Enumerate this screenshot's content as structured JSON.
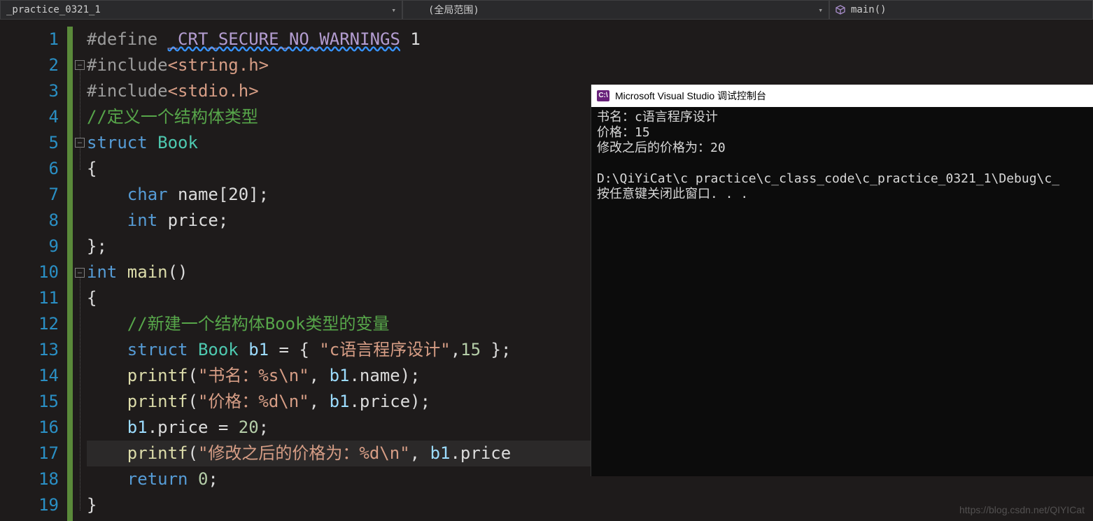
{
  "topbar": {
    "file_label": "_practice_0321_1",
    "scope_label": "(全局范围)",
    "func_label": "main()"
  },
  "gutter_start": 1,
  "gutter_end": 19,
  "code": {
    "l1_pp": "#define ",
    "l1_mac": "_CRT_SECURE_NO_WARNINGS",
    "l1_tail": " 1",
    "l2_pp": "#include",
    "l2_inc": "<string.h>",
    "l3_pp": "#include",
    "l3_inc": "<stdio.h>",
    "l4_cmt": "//定义一个结构体类型",
    "l5_kw": "struct ",
    "l5_typ": "Book",
    "l6_brace": "{",
    "l7_pre": "    ",
    "l7_kw": "char ",
    "l7_id": "name",
    "l7_tail": "[20];",
    "l8_pre": "    ",
    "l8_kw": "int ",
    "l8_id": "price",
    "l8_tail": ";",
    "l9_brace": "};",
    "l10_kw": "int ",
    "l10_fn": "main",
    "l10_tail": "()",
    "l11_brace": "{",
    "l12_pre": "    ",
    "l12_cmt": "//新建一个结构体Book类型的变量",
    "l13_pre": "    ",
    "l13_kw": "struct ",
    "l13_typ": "Book ",
    "l13_var": "b1",
    "l13_mid": " = { ",
    "l13_str": "\"c语言程序设计\"",
    "l13_mid2": ",",
    "l13_num": "15",
    "l13_tail": " };",
    "l14_pre": "    ",
    "l14_fn": "printf",
    "l14_open": "(",
    "l14_str": "\"书名：%s\\n\"",
    "l14_mid": ", ",
    "l14_var": "b1",
    "l14_mid2": ".",
    "l14_fld": "name",
    "l14_tail": ");",
    "l15_pre": "    ",
    "l15_fn": "printf",
    "l15_open": "(",
    "l15_str": "\"价格：%d\\n\"",
    "l15_mid": ", ",
    "l15_var": "b1",
    "l15_mid2": ".",
    "l15_fld": "price",
    "l15_tail": ");",
    "l16_pre": "    ",
    "l16_var": "b1",
    "l16_mid": ".",
    "l16_fld": "price",
    "l16_mid2": " = ",
    "l16_num": "20",
    "l16_tail": ";",
    "l17_pre": "    ",
    "l17_fn": "printf",
    "l17_open": "(",
    "l17_str": "\"修改之后的价格为：%d\\n\"",
    "l17_mid": ", ",
    "l17_var": "b1",
    "l17_mid2": ".",
    "l17_fld": "price",
    "l18_pre": "    ",
    "l18_kw": "return ",
    "l18_num": "0",
    "l18_tail": ";",
    "l19_brace": "}"
  },
  "console": {
    "title": "Microsoft Visual Studio 调试控制台",
    "l1": "书名：c语言程序设计",
    "l2": "价格：15",
    "l3": "修改之后的价格为：20",
    "l4": "D:\\QiYiCat\\c practice\\c_class_code\\c_practice_0321_1\\Debug\\c_",
    "l5": "按任意键关闭此窗口. . ."
  },
  "watermark": "https://blog.csdn.net/QIYICat"
}
